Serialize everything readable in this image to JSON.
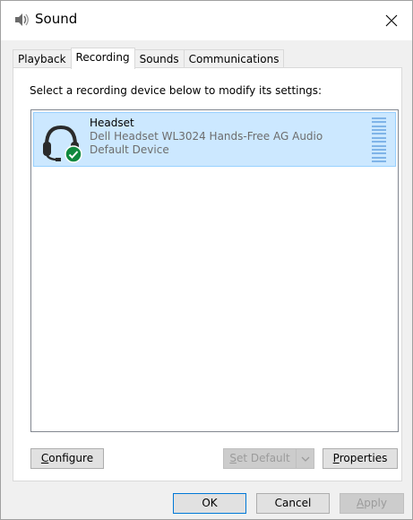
{
  "window": {
    "title": "Sound",
    "close_glyph": "✕"
  },
  "tabs": [
    {
      "label": "Playback",
      "active": false
    },
    {
      "label": "Recording",
      "active": true
    },
    {
      "label": "Sounds",
      "active": false
    },
    {
      "label": "Communications",
      "active": false
    }
  ],
  "recording": {
    "instruction": "Select a recording device below to modify its settings:",
    "devices": [
      {
        "name": "Headset",
        "description": "Dell Headset WL3024 Hands-Free AG Audio",
        "status": "Default Device",
        "icon": "headset-icon",
        "badge": "default-checkmark-icon",
        "selected": true,
        "level": 0
      }
    ],
    "configure_label_u": "C",
    "configure_label_rest": "onfigure",
    "set_default_label_u": "S",
    "set_default_label_rest": "et Default",
    "properties_label_u": "P",
    "properties_label_rest": "roperties"
  },
  "footer": {
    "ok_label": "OK",
    "cancel_label": "Cancel",
    "apply_label_u": "A",
    "apply_label_rest": "pply"
  },
  "colors": {
    "selection_bg": "#cce8ff",
    "selection_border": "#99d1ff",
    "badge_green": "#10893e",
    "meter_blue": "#7fb4e8"
  }
}
